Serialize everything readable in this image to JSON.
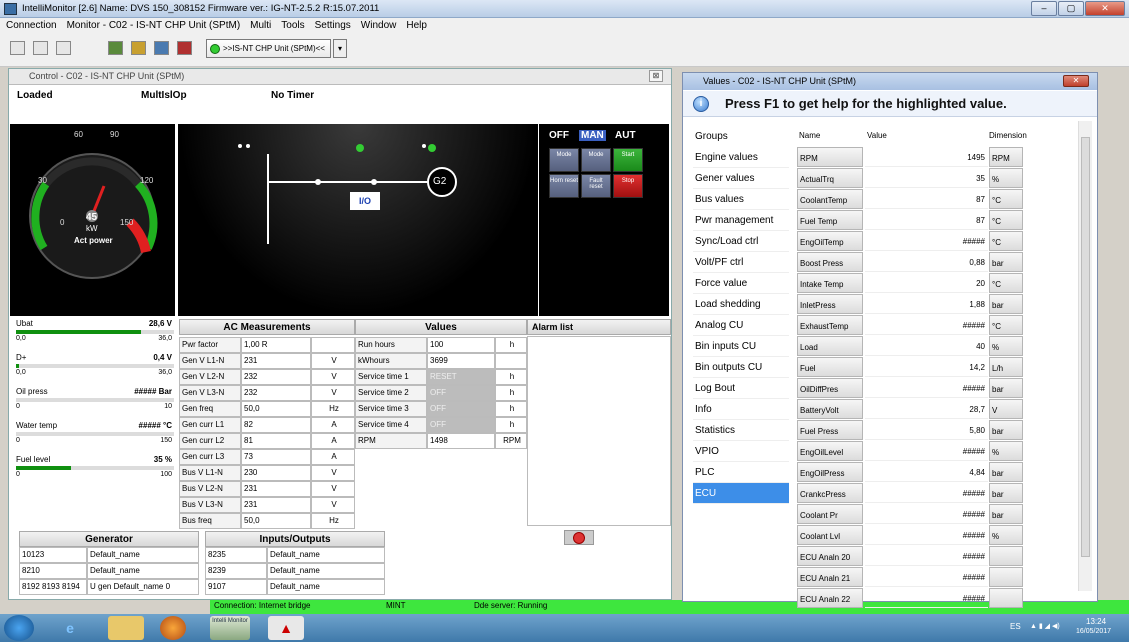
{
  "app": {
    "title": "IntelliMonitor [2.6] Name: DVS 150_308152 Firmware ver.: IG-NT-2.5.2 R:15.07.2011",
    "window_buttons": [
      "–",
      "▢",
      "✕"
    ]
  },
  "menu": [
    "Connection",
    "Monitor - C02 - IS-NT CHP Unit (SPtM)",
    "Multi",
    "Tools",
    "Settings",
    "Window",
    "Help"
  ],
  "toolbar": {
    "unit_combo": ">>IS-NT CHP Unit (SPtM)<<",
    "dropdown": "▾"
  },
  "control": {
    "title": "Control - C02 - IS-NT CHP Unit (SPtM)",
    "close": "⊠",
    "status": [
      "Loaded",
      "MultIslOp",
      "No Timer"
    ],
    "gauge": {
      "ticks": [
        "60",
        "90",
        "30",
        "120",
        "0",
        "150"
      ],
      "value": "45",
      "unit": "kW",
      "label": "Act power"
    },
    "g2": "G2",
    "io": "I/O",
    "mode": {
      "off": "OFF",
      "man": "MAN",
      "aut": "AUT"
    },
    "mode_buttons": [
      "Mode",
      "Mode",
      "Start",
      "Horn reset",
      "Fault reset",
      "Stop"
    ],
    "analog": [
      {
        "name": "Ubat",
        "value": "28,6 V",
        "min": "0,0",
        "max": "36,0",
        "fill": 0.79
      },
      {
        "name": "D+",
        "value": "0,4 V",
        "min": "0,0",
        "max": "36,0",
        "fill": 0.02
      },
      {
        "name": "Oil press",
        "value": "##### Bar",
        "min": "0",
        "max": "10",
        "fill": 0.0
      },
      {
        "name": "Water temp",
        "value": "##### °C",
        "min": "0",
        "max": "150",
        "fill": 0.0
      },
      {
        "name": "Fuel level",
        "value": "35 %",
        "min": "0",
        "max": "100",
        "fill": 0.35
      }
    ],
    "ac_header": "AC Measurements",
    "ac_rows": [
      [
        "Pwr factor",
        "1,00 R",
        ""
      ],
      [
        "Gen V L1-N",
        "231",
        "V"
      ],
      [
        "Gen V L2-N",
        "232",
        "V"
      ],
      [
        "Gen V L3-N",
        "232",
        "V"
      ],
      [
        "Gen freq",
        "50,0",
        "Hz"
      ],
      [
        "Gen curr L1",
        "82",
        "A"
      ],
      [
        "Gen curr L2",
        "81",
        "A"
      ],
      [
        "Gen curr L3",
        "73",
        "A"
      ],
      [
        "Bus V L1-N",
        "230",
        "V"
      ],
      [
        "Bus V L2-N",
        "231",
        "V"
      ],
      [
        "Bus V L3-N",
        "231",
        "V"
      ],
      [
        "Bus freq",
        "50,0",
        "Hz"
      ]
    ],
    "values_header": "Values",
    "values_rows": [
      [
        "Run hours",
        "100",
        "h"
      ],
      [
        "kWhours",
        "3699",
        ""
      ],
      [
        "Service time 1",
        "RESET",
        "h"
      ],
      [
        "Service time 2",
        "OFF",
        "h"
      ],
      [
        "Service time 3",
        "OFF",
        "h"
      ],
      [
        "Service time 4",
        "OFF",
        "h"
      ],
      [
        "RPM",
        "1498",
        "RPM"
      ]
    ],
    "alarm_header": "Alarm list",
    "generator_header": "Generator",
    "generator_rows": [
      [
        "10123",
        "Default_name"
      ],
      [
        "8210",
        "Default_name"
      ],
      [
        "8192 8193 8194",
        "U gen Default_name 0"
      ]
    ],
    "io_header": "Inputs/Outputs",
    "io_rows": [
      [
        "8235",
        "Default_name"
      ],
      [
        "8239",
        "Default_name"
      ],
      [
        "9107",
        "Default_name"
      ]
    ]
  },
  "statusbar": {
    "connection": "Connection: Internet bridge",
    "mode": "MINT",
    "dde": "Dde server: Running"
  },
  "values": {
    "title": "Values - C02 - IS-NT CHP Unit (SPtM)",
    "close": "✕",
    "help": "Press F1 to get help for the highlighted value.",
    "groups_header": "Groups",
    "groups": [
      "Engine values",
      "Gener values",
      "Bus values",
      "Pwr management",
      "Sync/Load ctrl",
      "Volt/PF ctrl",
      "Force value",
      "Load shedding",
      "Analog CU",
      "Bin inputs CU",
      "Bin outputs CU",
      "Log Bout",
      "Info",
      "Statistics",
      "VPIO",
      "PLC",
      "ECU"
    ],
    "selected_group": "ECU",
    "col_name": "Name",
    "col_value": "Value",
    "col_dim": "Dimension",
    "rows": [
      [
        "RPM",
        "1495",
        "RPM"
      ],
      [
        "ActualTrq",
        "35",
        "%"
      ],
      [
        "CoolantTemp",
        "87",
        "°C"
      ],
      [
        "Fuel Temp",
        "87",
        "°C"
      ],
      [
        "EngOilTemp",
        "#####",
        "°C"
      ],
      [
        "Boost Press",
        "0,88",
        "bar"
      ],
      [
        "Intake Temp",
        "20",
        "°C"
      ],
      [
        "InletPress",
        "1,88",
        "bar"
      ],
      [
        "ExhaustTemp",
        "#####",
        "°C"
      ],
      [
        "Load",
        "40",
        "%"
      ],
      [
        "Fuel",
        "14,2",
        "L/h"
      ],
      [
        "OilDiffPres",
        "#####",
        "bar"
      ],
      [
        "BatteryVolt",
        "28,7",
        "V"
      ],
      [
        "Fuel Press",
        "5,80",
        "bar"
      ],
      [
        "EngOilLevel",
        "#####",
        "%"
      ],
      [
        "EngOilPress",
        "4,84",
        "bar"
      ],
      [
        "CrankcPress",
        "#####",
        "bar"
      ],
      [
        "Coolant Pr",
        "#####",
        "bar"
      ],
      [
        "Coolant Lvl",
        "#####",
        "%"
      ],
      [
        "ECU Analn 20",
        "#####",
        ""
      ],
      [
        "ECU Analn 21",
        "#####",
        ""
      ],
      [
        "ECU Analn 22",
        "#####",
        ""
      ]
    ]
  },
  "taskbar": {
    "tray": "ES",
    "time": "13:24",
    "date": "16/05/2017",
    "app_label": "Intelli Monitor"
  },
  "colors": {
    "accent": "#3d8ee8",
    "statusbar": "#3ee63e",
    "gauge_red": "#e02020",
    "gauge_green": "#20b020"
  }
}
